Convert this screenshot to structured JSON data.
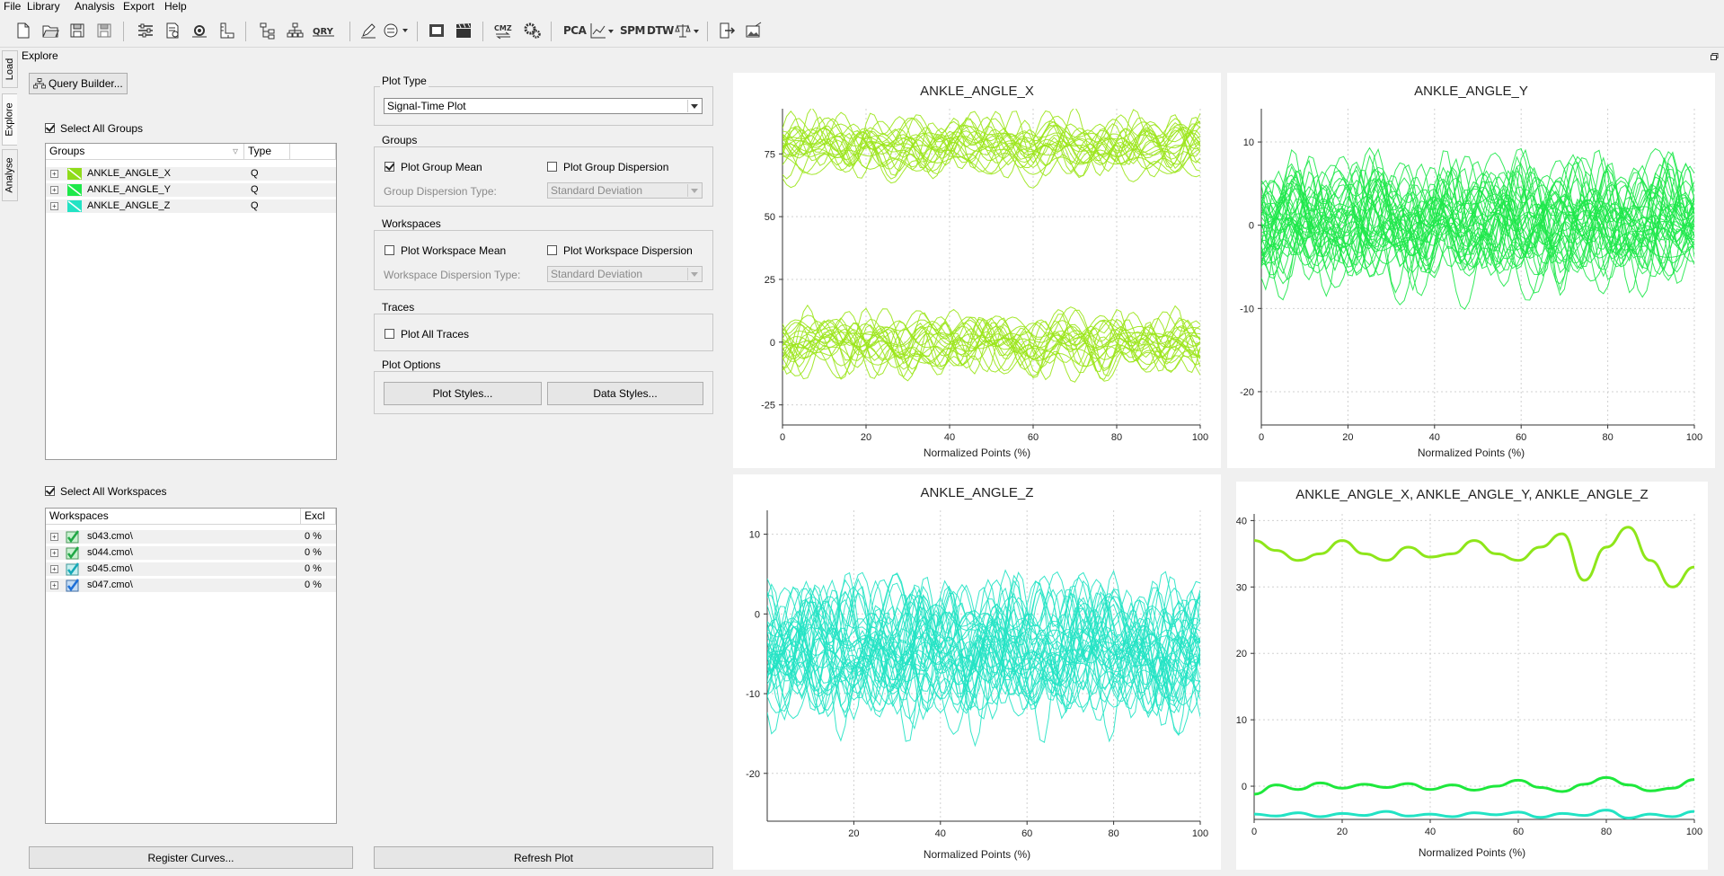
{
  "menu": [
    "File",
    "Library",
    "Analysis",
    "Export",
    "Help"
  ],
  "toolbar": {
    "icons": [
      "new-file",
      "open-folder",
      "save",
      "save-all",
      "sliders",
      "document-settings",
      "gear-settings",
      "ruler",
      "hierarchy-tree",
      "network",
      "query",
      "pen-edit",
      "pattern-dropdown",
      "film-frames",
      "clapperboard",
      "cmz-exchange",
      "cogs"
    ],
    "text_buttons": [
      "PCA",
      "SPM",
      "DTW"
    ],
    "trailing_icons": [
      "line-chart-dropdown",
      "balance-dropdown",
      "export",
      "image-export"
    ]
  },
  "side_tabs": [
    "Load",
    "Explore",
    "Analyse"
  ],
  "panel_title": "Explore",
  "query_builder_label": "Query Builder...",
  "select_all_groups": "Select All Groups",
  "groups_table": {
    "headers": [
      "Groups",
      "Type"
    ],
    "rows": [
      {
        "name": "ANKLE_ANGLE_X",
        "type": "Q"
      },
      {
        "name": "ANKLE_ANGLE_Y",
        "type": "Q"
      },
      {
        "name": "ANKLE_ANGLE_Z",
        "type": "Q"
      }
    ]
  },
  "select_all_workspaces": "Select All Workspaces",
  "workspaces_table": {
    "headers": [
      "Workspaces",
      "Excl"
    ],
    "rows": [
      {
        "name": "s043.cmo\\",
        "excl": "0 %"
      },
      {
        "name": "s044.cmo\\",
        "excl": "0 %"
      },
      {
        "name": "s045.cmo\\",
        "excl": "0 %"
      },
      {
        "name": "s047.cmo\\",
        "excl": "0 %"
      }
    ]
  },
  "register_curves_label": "Register Curves...",
  "refresh_plot_label": "Refresh Plot",
  "plot_type": {
    "title": "Plot Type",
    "value": "Signal-Time Plot"
  },
  "groups_box": {
    "title": "Groups",
    "plot_group_mean": "Plot Group Mean",
    "plot_group_dispersion": "Plot Group Dispersion",
    "dispersion_type_label": "Group Dispersion Type:",
    "dispersion_type_value": "Standard Deviation"
  },
  "workspaces_box": {
    "title": "Workspaces",
    "plot_workspace_mean": "Plot Workspace Mean",
    "plot_workspace_dispersion": "Plot Workspace Dispersion",
    "dispersion_type_label": "Workspace Dispersion Type:",
    "dispersion_type_value": "Standard Deviation"
  },
  "traces_box": {
    "title": "Traces",
    "plot_all_traces": "Plot All Traces"
  },
  "plot_options": {
    "title": "Plot Options",
    "plot_styles": "Plot Styles...",
    "data_styles": "Data Styles..."
  },
  "chart_data": [
    {
      "type": "line",
      "title": "ANKLE_ANGLE_X",
      "xlabel": "Normalized Points (%)",
      "xlim": [
        0,
        100
      ],
      "ylim": [
        -33,
        93
      ],
      "xticks": [
        0,
        20,
        40,
        60,
        80,
        100
      ],
      "yticks": [
        -25,
        0,
        25,
        50,
        75
      ],
      "color": "#9be61a",
      "bands": [
        {
          "center": 78,
          "spread": 16,
          "count": 22
        },
        {
          "center": 0,
          "spread": 16,
          "count": 22
        }
      ]
    },
    {
      "type": "line",
      "title": "ANKLE_ANGLE_Y",
      "xlabel": "Normalized Points (%)",
      "xlim": [
        0,
        100
      ],
      "ylim": [
        -24,
        14
      ],
      "xticks": [
        0,
        20,
        40,
        60,
        80,
        100
      ],
      "yticks": [
        -20,
        -10,
        0,
        10
      ],
      "color": "#1ee84a",
      "bands": [
        {
          "center": 0,
          "spread": 10,
          "count": 40
        }
      ]
    },
    {
      "type": "line",
      "title": "ANKLE_ANGLE_Z",
      "xlabel": "Normalized Points (%)",
      "xlim": [
        0,
        100
      ],
      "ylim": [
        -26,
        13
      ],
      "xticks": [
        20,
        40,
        60,
        80,
        100
      ],
      "yticks": [
        -20,
        -10,
        0,
        10
      ],
      "color": "#22e3c4",
      "bands": [
        {
          "center": -5,
          "spread": 12,
          "count": 40
        }
      ]
    },
    {
      "type": "line",
      "title": "ANKLE_ANGLE_X, ANKLE_ANGLE_Y, ANKLE_ANGLE_Z",
      "xlabel": "Normalized Points (%)",
      "xlim": [
        0,
        100
      ],
      "ylim": [
        -5,
        41
      ],
      "xticks": [
        0,
        20,
        40,
        60,
        80,
        100
      ],
      "yticks": [
        0,
        10,
        20,
        30,
        40
      ],
      "series": [
        {
          "color": "#8ee61a",
          "x": [
            0,
            5,
            10,
            15,
            20,
            25,
            30,
            35,
            40,
            45,
            50,
            55,
            60,
            65,
            70,
            75,
            80,
            85,
            90,
            95,
            100
          ],
          "y": [
            37,
            35.5,
            34,
            35,
            37,
            35,
            34,
            36,
            34.5,
            35,
            37,
            35,
            34,
            36,
            38,
            31,
            36,
            39,
            34,
            30,
            33
          ]
        },
        {
          "color": "#1ee83c",
          "x": [
            0,
            5,
            10,
            15,
            20,
            25,
            30,
            35,
            40,
            45,
            50,
            55,
            60,
            65,
            70,
            75,
            80,
            85,
            90,
            95,
            100
          ],
          "y": [
            -1.2,
            0.2,
            -0.5,
            0.5,
            -0.3,
            0.3,
            -0.2,
            0.4,
            -0.5,
            0.2,
            -0.6,
            0.0,
            0.9,
            -0.2,
            -0.8,
            0.3,
            1.3,
            0.2,
            -0.7,
            -0.3,
            1.0
          ]
        },
        {
          "color": "#22e3c4",
          "x": [
            0,
            5,
            10,
            15,
            20,
            25,
            30,
            35,
            40,
            45,
            50,
            55,
            60,
            65,
            70,
            75,
            80,
            85,
            90,
            95,
            100
          ],
          "y": [
            -4.2,
            -4.5,
            -4.0,
            -4.6,
            -4.1,
            -4.4,
            -3.8,
            -4.5,
            -4.2,
            -4.6,
            -4.0,
            -4.3,
            -3.9,
            -4.7,
            -4.1,
            -4.4,
            -3.6,
            -4.8,
            -4.2,
            -4.6,
            -3.8
          ]
        }
      ]
    }
  ]
}
